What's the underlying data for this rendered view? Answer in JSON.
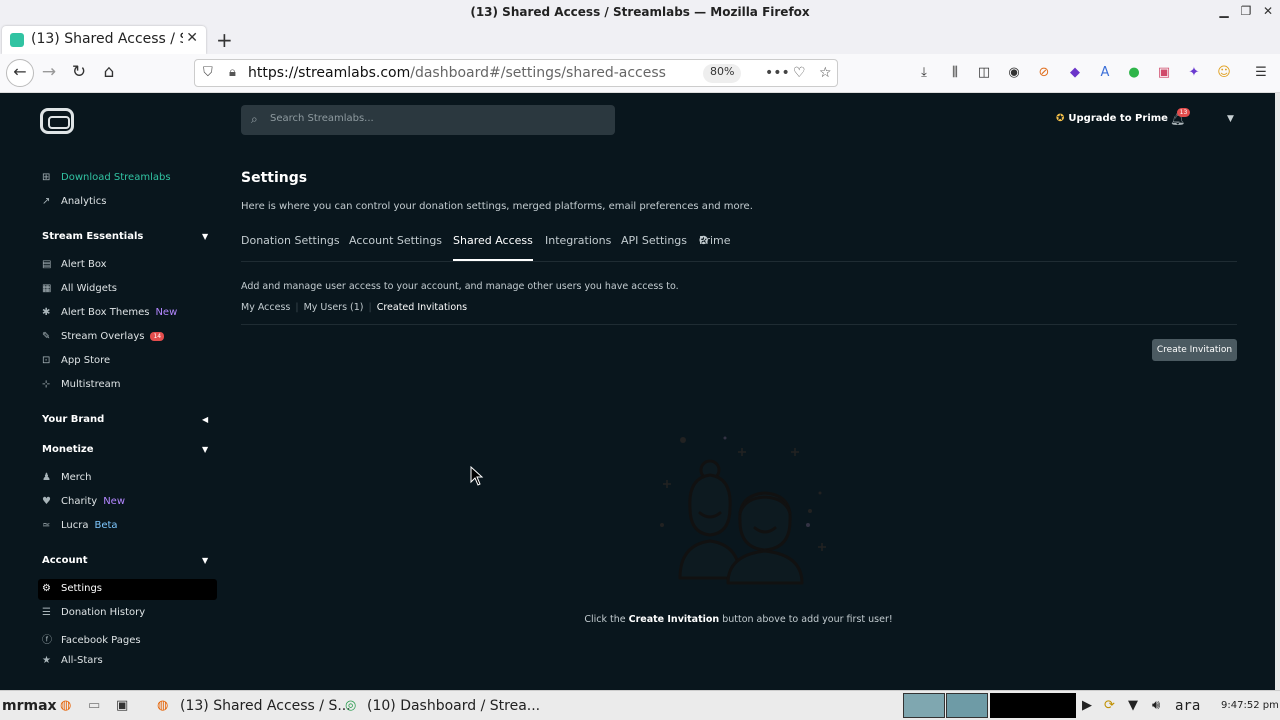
{
  "window": {
    "title": "(13) Shared Access / Streamlabs — Mozilla Firefox",
    "minimize_icon": "minimize-icon",
    "maximize_icon": "maximize-icon",
    "close_icon": "close-icon"
  },
  "browser": {
    "tab_title": "(13) Shared Access / S",
    "new_tab_label": "+",
    "url_host": "https://streamlabs.com",
    "url_path": "/dashboard#/settings/shared-access",
    "zoom": "80%",
    "ellipsis": "•••"
  },
  "header": {
    "search_placeholder": "Search Streamlabs...",
    "upgrade_label": "Upgrade to Prime",
    "notification_count": "13"
  },
  "sidebar": {
    "top_items": [
      {
        "label": "Download Streamlabs",
        "icon": "windows-icon"
      },
      {
        "label": "Analytics",
        "icon": "chart-icon"
      }
    ],
    "stream_essentials": {
      "heading": "Stream Essentials",
      "items": [
        {
          "label": "Alert Box"
        },
        {
          "label": "All Widgets"
        },
        {
          "label": "Alert Box Themes",
          "tag": "New"
        },
        {
          "label": "Stream Overlays",
          "badge": "14"
        },
        {
          "label": "App Store"
        },
        {
          "label": "Multistream"
        }
      ]
    },
    "your_brand": {
      "heading": "Your Brand"
    },
    "monetize": {
      "heading": "Monetize",
      "items": [
        {
          "label": "Merch"
        },
        {
          "label": "Charity",
          "tag": "New"
        },
        {
          "label": "Lucra",
          "tag": "Beta"
        }
      ]
    },
    "account": {
      "heading": "Account",
      "items": [
        {
          "label": "Settings"
        },
        {
          "label": "Donation History"
        },
        {
          "label": "Facebook Pages"
        },
        {
          "label": "All-Stars"
        }
      ]
    }
  },
  "main": {
    "title": "Settings",
    "description": "Here is where you can control your donation settings, merged platforms, email preferences and more.",
    "tabs": [
      {
        "label": "Donation Settings"
      },
      {
        "label": "Account Settings"
      },
      {
        "label": "Shared Access"
      },
      {
        "label": "Integrations"
      },
      {
        "label": "API Settings"
      },
      {
        "label": "Prime"
      }
    ],
    "access_description": "Add and manage user access to your account, and manage other users you have access to.",
    "subtabs": [
      {
        "label": "My Access"
      },
      {
        "label": "My Users (1)"
      },
      {
        "label": "Created Invitations"
      }
    ],
    "create_button": "Create Invitation",
    "empty_prefix": "Click the ",
    "empty_bold": "Create Invitation",
    "empty_suffix": " button above to add your first user!"
  },
  "taskbar": {
    "user": "mrmax",
    "task1": "(13) Shared Access / S...",
    "task2": "(10) Dashboard / Strea...",
    "keyboard_layout": "ara",
    "clock": "9:47:52 pm"
  },
  "colors": {
    "background": "#09161d",
    "accent_green": "#31c3a2",
    "new_tag": "#b387ff",
    "badge_red": "#e34d4d"
  }
}
